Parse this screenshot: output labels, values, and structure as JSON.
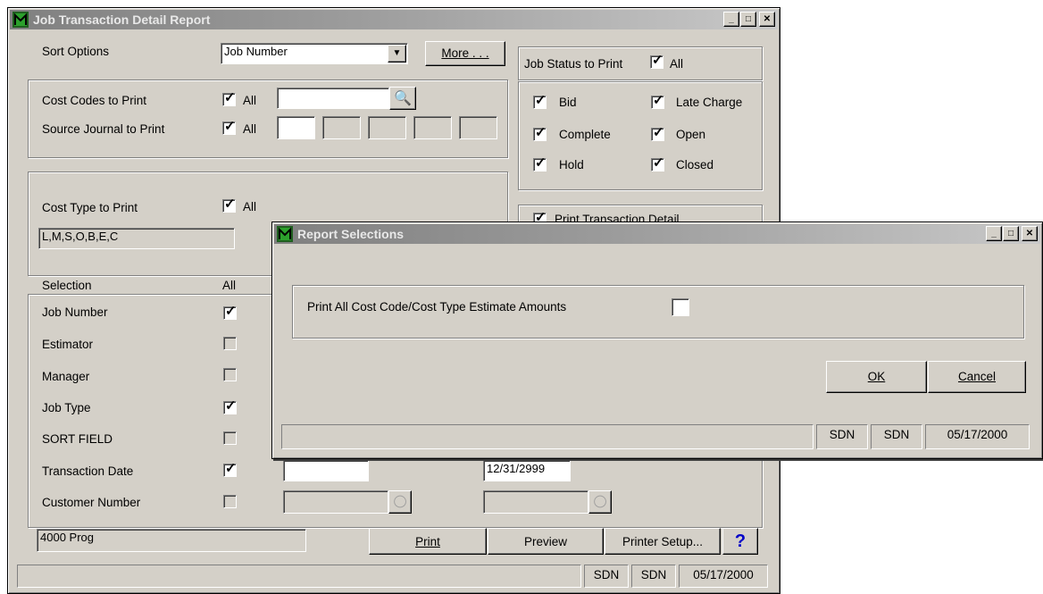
{
  "main": {
    "title": "Job Transaction Detail Report",
    "sort_label": "Sort Options",
    "sort_value": "Job Number",
    "more_button": "More . . .",
    "cost_codes_label": "Cost Codes to Print",
    "source_journal_label": "Source Journal to Print",
    "all_label": "All",
    "cost_type_label": "Cost Type to Print",
    "cost_type_value": "L,M,S,O,B,E,C",
    "job_status_label": "Job Status to Print",
    "status_checks": {
      "bid": "Bid",
      "late_charge": "Late Charge",
      "complete": "Complete",
      "open": "Open",
      "hold": "Hold",
      "closed": "Closed"
    },
    "print_detail_label": "Print Transaction Detail",
    "selection_header": "Selection",
    "selection_all_header": "All",
    "selection_rows": {
      "job_number": "Job Number",
      "estimator": "Estimator",
      "manager": "Manager",
      "job_type": "Job Type",
      "sort_field": "SORT FIELD",
      "transaction_date": "Transaction Date",
      "customer_number": "Customer Number"
    },
    "transaction_date_to": "12/31/2999",
    "form_name": "4000 Prog",
    "buttons": {
      "print": "Print",
      "preview": "Preview",
      "printer_setup": "Printer Setup...",
      "help": "?"
    },
    "status_bar": {
      "user1": "SDN",
      "user2": "SDN",
      "date": "05/17/2000"
    }
  },
  "dialog": {
    "title": "Report Selections",
    "option_label": "Print All Cost Code/Cost Type Estimate Amounts",
    "ok_button": "OK",
    "cancel_button": "Cancel",
    "status_bar": {
      "user1": "SDN",
      "user2": "SDN",
      "date": "05/17/2000"
    }
  }
}
